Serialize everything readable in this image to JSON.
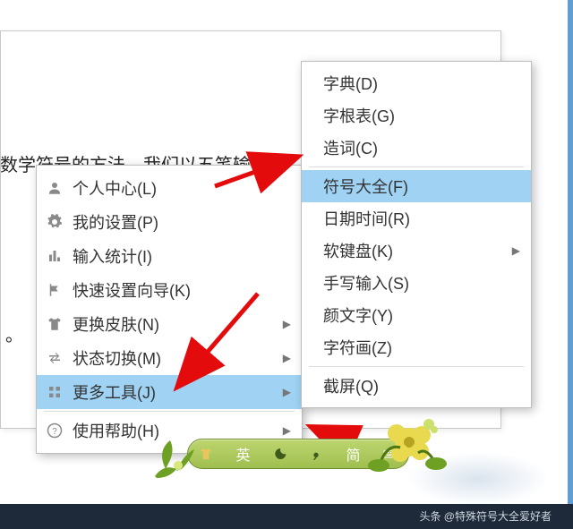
{
  "doc": {
    "line1": "数学符号的方法。我们以五笔输入",
    "line2": "。"
  },
  "menu1": {
    "items": [
      {
        "label": "个人中心(L)",
        "icon": "person-icon",
        "sub": false
      },
      {
        "label": "我的设置(P)",
        "icon": "gear-icon",
        "sub": false
      },
      {
        "label": "输入统计(I)",
        "icon": "bars-icon",
        "sub": false
      },
      {
        "label": "快速设置向导(K)",
        "icon": "flag-icon",
        "sub": false
      },
      {
        "label": "更换皮肤(N)",
        "icon": "shirt-icon",
        "sub": true
      },
      {
        "label": "状态切换(M)",
        "icon": "swap-icon",
        "sub": true
      },
      {
        "label": "更多工具(J)",
        "icon": "grid-icon",
        "sub": true,
        "highlight": true
      },
      {
        "label": "使用帮助(H)",
        "icon": "help-icon",
        "sub": true
      }
    ]
  },
  "menu2": {
    "items": [
      {
        "label": "字典(D)",
        "sub": false
      },
      {
        "label": "字根表(G)",
        "sub": false
      },
      {
        "label": "造词(C)",
        "sub": false
      },
      {
        "sep": true
      },
      {
        "label": "符号大全(F)",
        "sub": false,
        "highlight": true
      },
      {
        "label": "日期时间(R)",
        "sub": false
      },
      {
        "label": "软键盘(K)",
        "sub": true
      },
      {
        "label": "手写输入(S)",
        "sub": false
      },
      {
        "label": "颜文字(Y)",
        "sub": false
      },
      {
        "label": "字符画(Z)",
        "sub": false
      },
      {
        "sep": true
      },
      {
        "label": "截屏(Q)",
        "sub": false
      }
    ]
  },
  "ime": {
    "lang": "英",
    "mode": "简"
  },
  "watermark": "头条 @特殊符号大全爱好者"
}
